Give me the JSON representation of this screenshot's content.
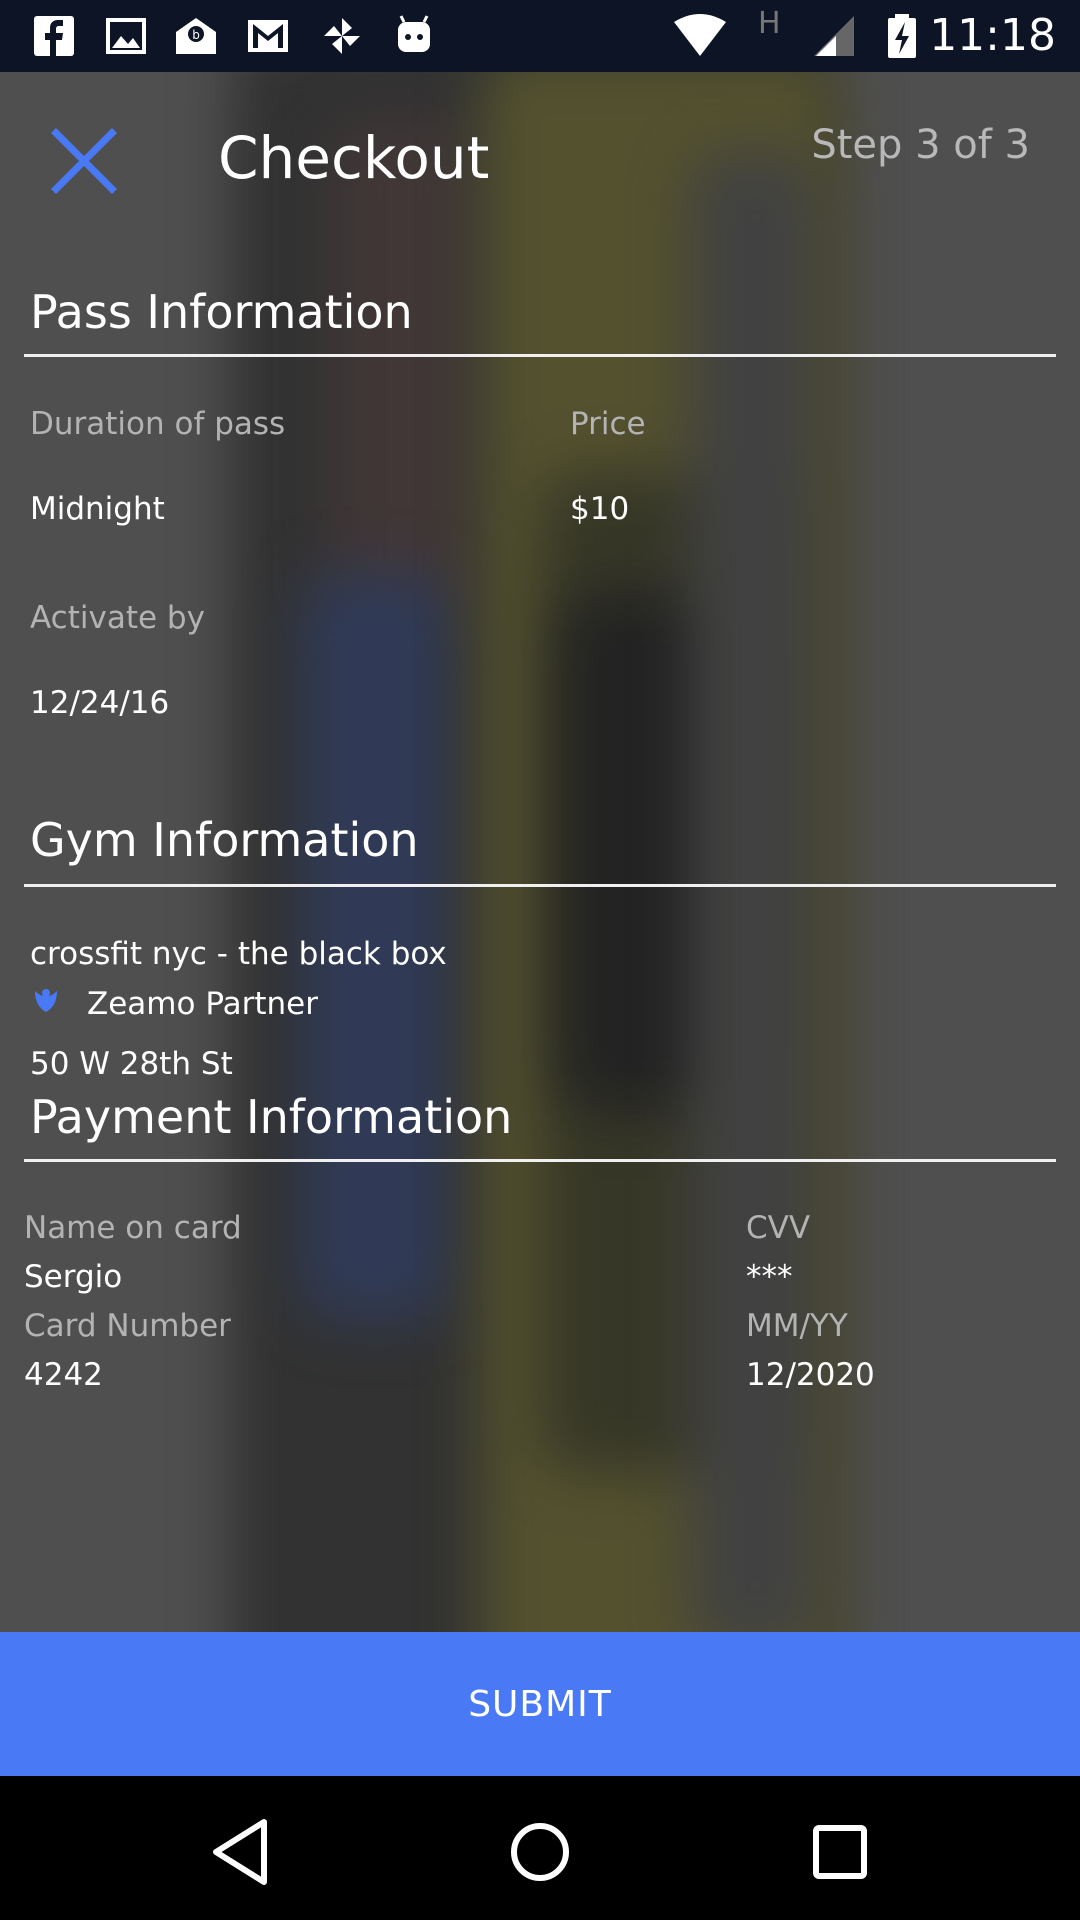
{
  "status_bar": {
    "time": "11:18",
    "icons": [
      "facebook-icon",
      "gallery-icon",
      "mail-open-icon",
      "gmail-icon",
      "pinwheel-icon",
      "android-icon",
      "wifi-icon",
      "h-network-icon",
      "signal-icon",
      "battery-charging-icon"
    ]
  },
  "header": {
    "title": "Checkout",
    "step": "Step 3 of 3",
    "close_icon": "close-icon"
  },
  "pass_info": {
    "heading": "Pass Information",
    "duration_label": "Duration of pass",
    "duration_value": "Midnight",
    "price_label": "Price",
    "price_value": "$10",
    "activate_label": "Activate by",
    "activate_value": "12/24/16"
  },
  "gym_info": {
    "heading": "Gym Information",
    "name": "crossfit nyc - the black box",
    "partner": "Zeamo Partner",
    "address": "50 W 28th St"
  },
  "payment_info": {
    "heading": "Payment Information",
    "name_label": "Name on card",
    "name_value": "Sergio",
    "cvv_label": "CVV",
    "cvv_value": "***",
    "card_label": "Card Number",
    "card_value": "4242",
    "exp_label": "MM/YY",
    "exp_value": "12/2020"
  },
  "submit_label": "SUBMIT",
  "colors": {
    "accent": "#4a79f5",
    "status_bar": "#0c1426",
    "background": "#4f4f4f"
  }
}
